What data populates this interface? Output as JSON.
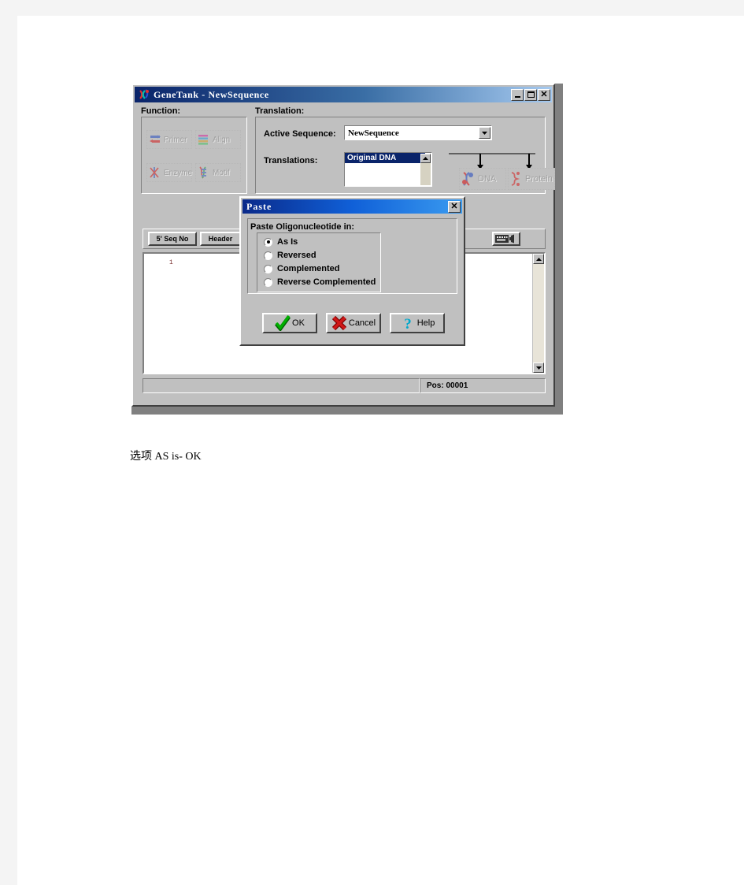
{
  "window": {
    "title": "GeneTank - NewSequence",
    "icon": "genetank-app-icon",
    "controls": {
      "minimize": "_",
      "maximize": "□",
      "close": "✕"
    }
  },
  "function_panel": {
    "label": "Function:",
    "buttons": [
      {
        "label": "Primer",
        "icon": "primer-icon",
        "enabled": false
      },
      {
        "label": "Align",
        "icon": "align-icon",
        "enabled": false
      },
      {
        "label": "Enzyme",
        "icon": "enzyme-icon",
        "enabled": false
      },
      {
        "label": "Motif",
        "icon": "motif-icon",
        "enabled": false
      }
    ]
  },
  "translation_panel": {
    "label": "Translation:",
    "active_sequence_label": "Active Sequence:",
    "active_sequence_value": "NewSequence",
    "translations_label": "Translations:",
    "translations_items": [
      "Original DNA"
    ],
    "translations_selected": "Original DNA",
    "output_buttons": [
      {
        "label": "DNA",
        "icon": "dna-icon",
        "enabled": false
      },
      {
        "label": "Protein",
        "icon": "protein-icon",
        "enabled": false
      }
    ]
  },
  "toolbar": {
    "buttons": [
      {
        "label": "5' Seq No",
        "name": "seq-no-button"
      },
      {
        "label": "Header",
        "name": "header-button"
      }
    ],
    "keyboard_button_icon": "keyboard-sound-icon"
  },
  "editor": {
    "line_number": "1",
    "content": ""
  },
  "status_bar": {
    "message": "",
    "position_label": "Pos:  00001"
  },
  "paste_dialog": {
    "title": "Paste",
    "close_label": "✕",
    "heading": "Paste Oligonucleotide in:",
    "options": [
      {
        "label": "As Is",
        "selected": true
      },
      {
        "label": "Reversed",
        "selected": false
      },
      {
        "label": "Complemented",
        "selected": false
      },
      {
        "label": "Reverse Complemented",
        "selected": false
      }
    ],
    "buttons": [
      {
        "label": "OK",
        "icon": "check-icon",
        "color": "#008000"
      },
      {
        "label": "Cancel",
        "icon": "x-icon",
        "color": "#c00000"
      },
      {
        "label": "Help",
        "icon": "question-icon",
        "color": "#00a0c0"
      }
    ]
  },
  "caption": "选项 AS is- OK",
  "colors": {
    "face": "#c0c0c0",
    "title_active": "#0a246a",
    "dialog_title": "#1060d8",
    "selection": "#0a246a",
    "linenum": "#7a3030"
  }
}
